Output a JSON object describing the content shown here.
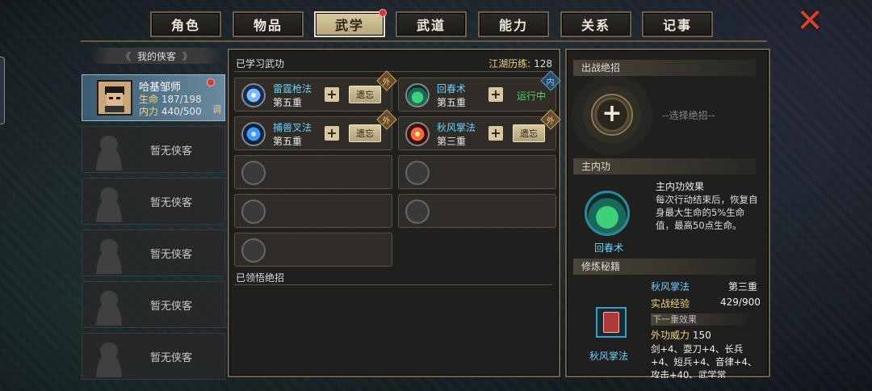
{
  "tabs": [
    {
      "label": "角色",
      "active": false,
      "badge": false
    },
    {
      "label": "物品",
      "active": false,
      "badge": false
    },
    {
      "label": "武学",
      "active": true,
      "badge": true
    },
    {
      "label": "武道",
      "active": false,
      "badge": false
    },
    {
      "label": "能力",
      "active": false,
      "badge": false
    },
    {
      "label": "关系",
      "active": false,
      "badge": false
    },
    {
      "label": "记事",
      "active": false,
      "badge": false
    }
  ],
  "close_icon": "close-x-icon",
  "left": {
    "title": "我的侠客",
    "character": {
      "name": "哈基邹师",
      "hp_label": "生命",
      "hp_value": "187/198",
      "mp_label": "内力",
      "mp_value": "440/500",
      "tag": "调"
    },
    "empty_label": "暂无侠客"
  },
  "middle": {
    "learned_title": "已学习武功",
    "exp_label": "江湖历练:",
    "exp_value": "128",
    "skills": [
      {
        "name": "雷霆枪法",
        "level": "第五重",
        "action": "遗忘",
        "tag": "外",
        "icon_color": "#7ab8ff"
      },
      {
        "name": "回春术",
        "level": "第五重",
        "action": "运行中",
        "tag": "内",
        "icon_color": "#3fd07a"
      },
      {
        "name": "捕兽叉法",
        "level": "第五重",
        "action": "遗忘",
        "tag": "外",
        "icon_color": "#3a9aff"
      },
      {
        "name": "秋风掌法",
        "level": "第三重",
        "action": "遗忘",
        "tag": "外",
        "icon_color": "#ff6a3a"
      }
    ],
    "comprehended_title": "已领悟绝招"
  },
  "right": {
    "ult_title": "出战绝招",
    "ult_placeholder": "--选择绝招--",
    "inner_title": "主内功",
    "inner_effect_title": "主内功效果",
    "inner_effect_desc": "每次行动结束后，恢复自身最大生命的5%生命值，最高50点生命。",
    "inner_name": "回春术",
    "manual_title": "修炼秘籍",
    "manual_skill": "秋风掌法",
    "manual_level": "第三重",
    "manual_exp_label": "实战经验",
    "manual_exp_value": "429/900",
    "next_label": "下一重效果",
    "power_label": "外功威力",
    "power_value": "150",
    "bonus_desc": "剑+4、耍刀+4、长兵+4、短兵+4、音律+4、攻击+40、武学常",
    "book_name": "秋风掌法"
  }
}
